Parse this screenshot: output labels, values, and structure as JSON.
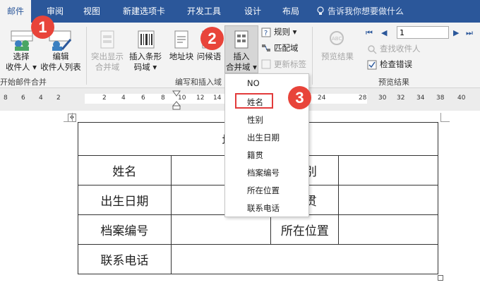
{
  "tabs": [
    {
      "label": "邮件",
      "active": true
    },
    {
      "label": "审阅"
    },
    {
      "label": "视图"
    },
    {
      "label": "新建选项卡"
    },
    {
      "label": "开发工具"
    },
    {
      "label": "设计"
    },
    {
      "label": "布局"
    }
  ],
  "tell_me": "告诉我你想要做什么",
  "ribbon": {
    "select_recipients": [
      "选择",
      "收件人 ▾"
    ],
    "edit_recipients": [
      "编辑",
      "收件人列表"
    ],
    "highlight_fields": [
      "突出显示",
      "合并域"
    ],
    "insert_barcode": [
      "插入条形",
      "码域 ▾"
    ],
    "address_block": "地址块",
    "greeting_line": "问候语",
    "insert_merge_field": [
      "插入",
      "合并域 ▾"
    ],
    "rules": "规则 ▾",
    "match_fields": "匹配域",
    "update_labels": "更新标签",
    "preview_results": "预览结果",
    "record_value": "1",
    "find_recipient": "查找收件人",
    "check_errors": "检查错误",
    "group_start": "开始邮件合并",
    "group_write": "编写和插入域",
    "group_preview": "预览结果"
  },
  "ruler": {
    "left": [
      "8",
      "6",
      "4",
      "2"
    ],
    "mid": [
      "2",
      "4",
      "6",
      "8",
      "10",
      "12",
      "14"
    ],
    "right": [
      "24",
      "28",
      "30",
      "32",
      "34",
      "38",
      "40"
    ]
  },
  "table": {
    "title": "培训人员标签",
    "rows": [
      [
        "姓名",
        "",
        "性别",
        ""
      ],
      [
        "出生日期",
        "",
        "籍贯",
        ""
      ],
      [
        "档案编号",
        "",
        "所在位置",
        ""
      ],
      [
        "联系电话",
        ""
      ]
    ]
  },
  "merge_fields": [
    "NO",
    "姓名",
    "性别",
    "出生日期",
    "籍贯",
    "档案编号",
    "所在位置",
    "联系电话"
  ],
  "callouts": [
    "1",
    "2",
    "3"
  ],
  "colors": {
    "ribbon_blue": "#2b579a",
    "callout_red": "#e8443a"
  }
}
